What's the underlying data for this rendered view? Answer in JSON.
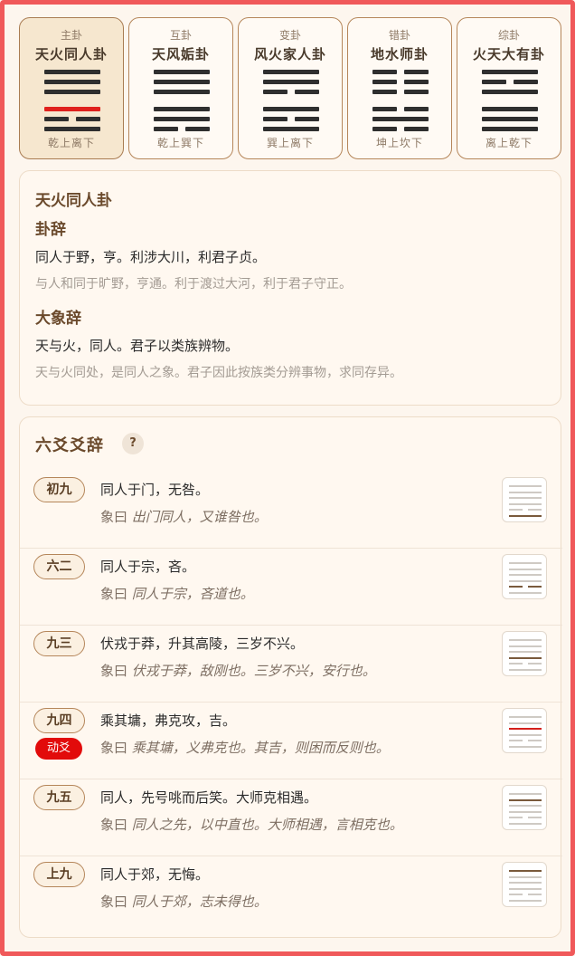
{
  "hexagrams": [
    {
      "type": "主卦",
      "name": "天火同人卦",
      "trigrams": "乾上离下",
      "lines": [
        1,
        1,
        1,
        1,
        0,
        1
      ],
      "moving": 3
    },
    {
      "type": "互卦",
      "name": "天风姤卦",
      "trigrams": "乾上巽下",
      "lines": [
        1,
        1,
        1,
        1,
        1,
        0
      ],
      "moving": -1
    },
    {
      "type": "变卦",
      "name": "风火家人卦",
      "trigrams": "巽上离下",
      "lines": [
        1,
        1,
        0,
        1,
        0,
        1
      ],
      "moving": -1
    },
    {
      "type": "错卦",
      "name": "地水师卦",
      "trigrams": "坤上坎下",
      "lines": [
        0,
        0,
        0,
        0,
        1,
        0
      ],
      "moving": -1
    },
    {
      "type": "综卦",
      "name": "火天大有卦",
      "trigrams": "离上乾下",
      "lines": [
        1,
        0,
        1,
        1,
        1,
        1
      ],
      "moving": -1
    }
  ],
  "detail": {
    "title": "天火同人卦",
    "gua_ci_label": "卦辞",
    "gua_ci": "同人于野，亨。利涉大川，利君子贞。",
    "gua_ci_trans": "与人和同于旷野，亨通。利于渡过大河，利于君子守正。",
    "xiang_label": "大象辞",
    "xiang_ci": "天与火，同人。君子以类族辨物。",
    "xiang_trans": "天与火同处，是同人之象。君子因此按族类分辨事物，求同存异。"
  },
  "yao_section": {
    "title": "六爻爻辞",
    "help_icon": "?",
    "xiang_prefix": "象曰",
    "moving_label": "动爻",
    "items": [
      {
        "pos": "初九",
        "text": "同人于门，无咎。",
        "xiang": "出门同人，又谁咎也。",
        "moving": false
      },
      {
        "pos": "六二",
        "text": "同人于宗，吝。",
        "xiang": "同人于宗，吝道也。",
        "moving": false
      },
      {
        "pos": "九三",
        "text": "伏戎于莽，升其高陵，三岁不兴。",
        "xiang": "伏戎于莽，敌刚也。三岁不兴，安行也。",
        "moving": false
      },
      {
        "pos": "九四",
        "text": "乘其墉，弗克攻，吉。",
        "xiang": "乘其墉，义弗克也。其吉，则困而反则也。",
        "moving": true
      },
      {
        "pos": "九五",
        "text": "同人，先号咷而后笑。大师克相遇。",
        "xiang": "同人之先，以中直也。大师相遇，言相克也。",
        "moving": false
      },
      {
        "pos": "上九",
        "text": "同人于郊，无悔。",
        "xiang": "同人于郊，志未得也。",
        "moving": false
      }
    ]
  },
  "colors": {
    "accent": "#6b4a2c",
    "moving": "#e20b0b",
    "frame": "#f0595a"
  }
}
